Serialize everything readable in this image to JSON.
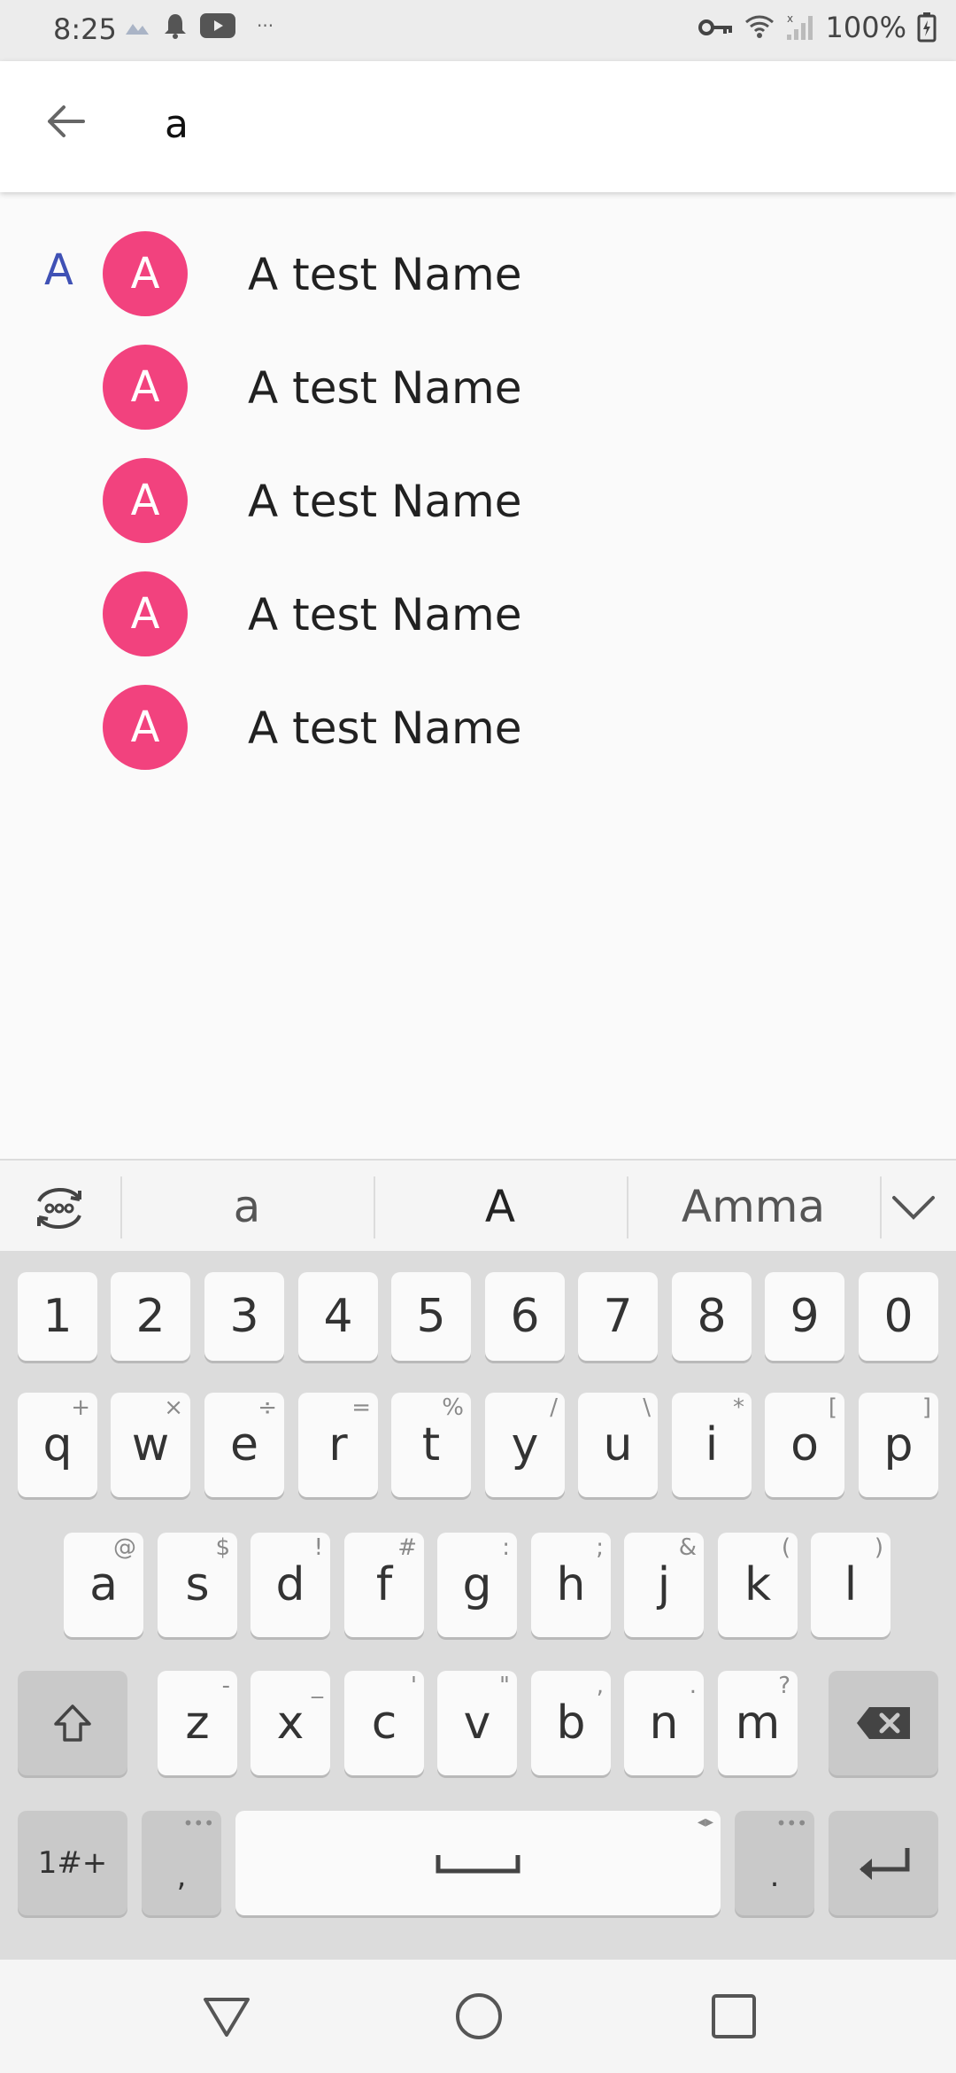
{
  "status_bar": {
    "time": "8:25",
    "battery": "100%",
    "left_icons": [
      "image-icon",
      "bell-icon",
      "youtube-icon",
      "more-icon"
    ],
    "right_icons": [
      "vpn-key-icon",
      "wifi-icon",
      "signal-icon",
      "battery-charging-icon"
    ]
  },
  "search": {
    "query": "a",
    "back_icon": "back-arrow-icon"
  },
  "contacts": {
    "section_letter": "A",
    "items": [
      {
        "initial": "A",
        "name": "A test Name"
      },
      {
        "initial": "A",
        "name": "A test Name"
      },
      {
        "initial": "A",
        "name": "A test Name"
      },
      {
        "initial": "A",
        "name": "A test Name"
      },
      {
        "initial": "A",
        "name": "A test Name"
      }
    ],
    "avatar_color": "#f2427e",
    "section_color": "#3f51b5"
  },
  "keyboard": {
    "suggestions": [
      "a",
      "A",
      "Amma"
    ],
    "number_row": [
      "1",
      "2",
      "3",
      "4",
      "5",
      "6",
      "7",
      "8",
      "9",
      "0"
    ],
    "row1": [
      {
        "key": "q",
        "hint": "+"
      },
      {
        "key": "w",
        "hint": "×"
      },
      {
        "key": "e",
        "hint": "÷"
      },
      {
        "key": "r",
        "hint": "="
      },
      {
        "key": "t",
        "hint": "%"
      },
      {
        "key": "y",
        "hint": "/"
      },
      {
        "key": "u",
        "hint": "\\"
      },
      {
        "key": "i",
        "hint": "*"
      },
      {
        "key": "o",
        "hint": "["
      },
      {
        "key": "p",
        "hint": "]"
      }
    ],
    "row2": [
      {
        "key": "a",
        "hint": "@"
      },
      {
        "key": "s",
        "hint": "$"
      },
      {
        "key": "d",
        "hint": "!"
      },
      {
        "key": "f",
        "hint": "#"
      },
      {
        "key": "g",
        "hint": ":"
      },
      {
        "key": "h",
        "hint": ";"
      },
      {
        "key": "j",
        "hint": "&"
      },
      {
        "key": "k",
        "hint": "("
      },
      {
        "key": "l",
        "hint": ")"
      }
    ],
    "row3": [
      {
        "key": "z",
        "hint": "-"
      },
      {
        "key": "x",
        "hint": "_"
      },
      {
        "key": "c",
        "hint": "'"
      },
      {
        "key": "v",
        "hint": "\""
      },
      {
        "key": "b",
        "hint": ","
      },
      {
        "key": "n",
        "hint": "."
      },
      {
        "key": "m",
        "hint": "?"
      }
    ],
    "symbols_key": "1#+",
    "comma_key": ",",
    "period_key": ".",
    "more_hint": "•••"
  },
  "nav_bar": {
    "icons": [
      "back-triangle-icon",
      "home-circle-icon",
      "recents-square-icon"
    ]
  }
}
